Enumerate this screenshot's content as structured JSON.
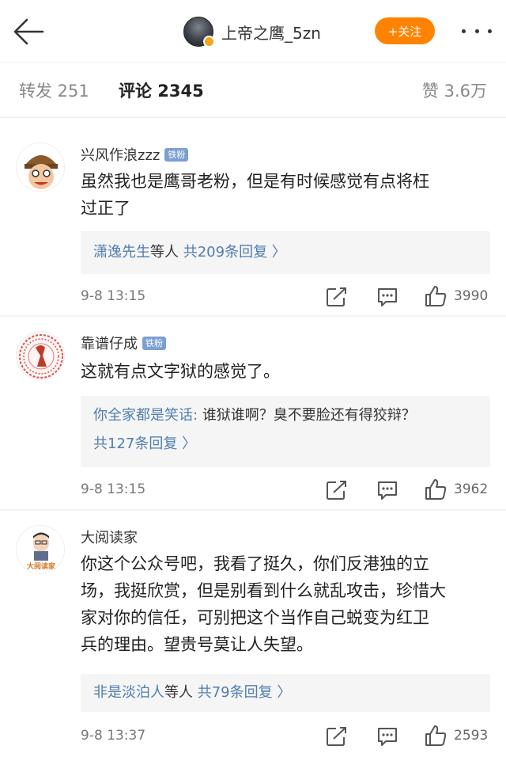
{
  "header": {
    "back_icon": "arrow-left-icon",
    "author_name": "上帝之鹰_5zn",
    "follow_label": "+关注",
    "more_icon": "more-dots-icon"
  },
  "tabs": {
    "repost": "转发 251",
    "comment": "评论 2345",
    "like": "赞 3.6万"
  },
  "comments": [
    {
      "name": "兴风作浪zzz",
      "badge": "铁粉",
      "text_lines": [
        "虽然我也是鹰哥老粉，但是有时候感觉有点将枉",
        "过正了"
      ],
      "reply_name": "潇逸先生",
      "reply_summary": "等人",
      "reply_count": "共209条回复 〉",
      "time": "9-8 13:15",
      "likes": "3990"
    },
    {
      "name": "靠谱仔成",
      "badge": "铁粉",
      "text_lines": [
        "这就有点文字狱的感觉了。"
      ],
      "reply_name": "你全家都是笑话:",
      "reply_text": "谁狱谁啊？臭不要脸还有得狡辩？",
      "reply_count": "共127条回复 〉",
      "time": "9-8 13:15",
      "likes": "3962"
    },
    {
      "name": "大阅读家",
      "text_lines": [
        "你这个公众号吧，我看了挺久，你们反港独的立",
        "场，我挺欣赏，但是别看到什么就乱攻击，珍惜大",
        "家对你的信任，可别把这个当作自己蜕变为红卫",
        "兵的理由。望贵号莫让人失望。"
      ],
      "avatar_text": "大阅读家",
      "reply_name": "非是淡泊人",
      "reply_summary": "等人",
      "reply_count": "共79条回复 〉",
      "time": "9-8 13:37",
      "likes": "2593"
    }
  ],
  "colors": {
    "accent": "#ff8200",
    "link": "#507daf",
    "badge": "#7b9fd1"
  }
}
